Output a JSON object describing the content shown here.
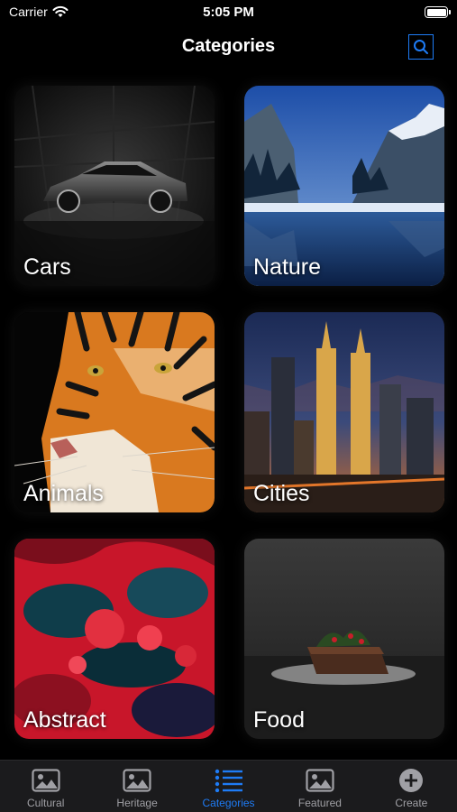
{
  "status_bar": {
    "carrier": "Carrier",
    "time": "5:05 PM"
  },
  "nav": {
    "title": "Categories"
  },
  "categories": [
    {
      "label": "Cars"
    },
    {
      "label": "Nature"
    },
    {
      "label": "Animals"
    },
    {
      "label": "Cities"
    },
    {
      "label": "Abstract"
    },
    {
      "label": "Food"
    }
  ],
  "tabs": [
    {
      "label": "Cultural",
      "icon": "photo-icon"
    },
    {
      "label": "Heritage",
      "icon": "photo-icon"
    },
    {
      "label": "Categories",
      "icon": "list-icon",
      "active": true
    },
    {
      "label": "Featured",
      "icon": "photo-icon"
    },
    {
      "label": "Create",
      "icon": "plus-circle-icon"
    }
  ],
  "colors": {
    "accent": "#1e7cf6",
    "tab_bar_bg": "#1b1b1d",
    "inactive": "#a0a0a5"
  }
}
